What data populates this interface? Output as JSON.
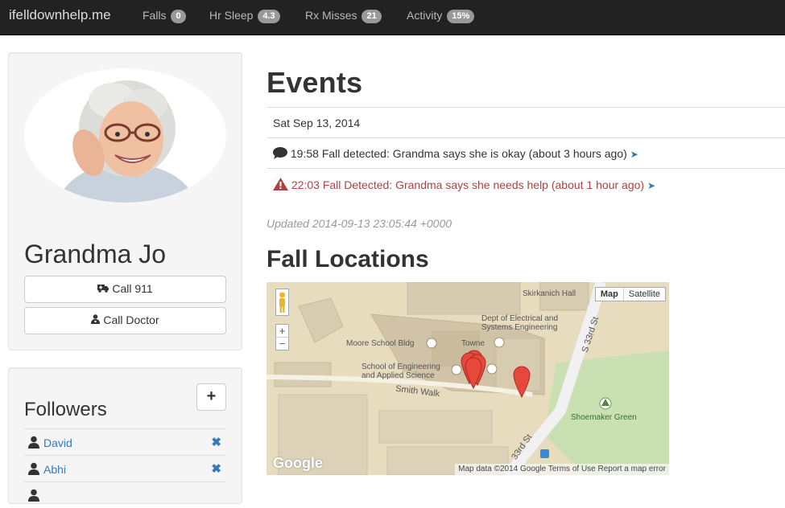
{
  "navbar": {
    "brand": "ifelldownhelp.me",
    "items": [
      {
        "label": "Falls",
        "badge": "0"
      },
      {
        "label": "Hr Sleep",
        "badge": "4.3"
      },
      {
        "label": "Rx Misses",
        "badge": "21"
      },
      {
        "label": "Activity",
        "badge": "15%"
      }
    ]
  },
  "profile": {
    "name": "Grandma Jo",
    "call_911": "Call 911",
    "call_doctor": "Call Doctor"
  },
  "followers": {
    "title": "Followers",
    "add_label": "+",
    "items": [
      {
        "name": "David"
      },
      {
        "name": "Abhi"
      }
    ]
  },
  "events": {
    "title": "Events",
    "date": "Sat Sep 13, 2014",
    "items": [
      {
        "text": "19:58 Fall detected: Grandma says she is okay (about 3 hours ago)",
        "type": "info",
        "icon": "comment-icon"
      },
      {
        "text": "22:03 Fall Detected: Grandma says she needs help (about 1 hour ago)",
        "type": "alert",
        "icon": "warning-icon"
      }
    ],
    "updated": "Updated 2014-09-13 23:05:44 +0000"
  },
  "fall_locations": {
    "title": "Fall Locations",
    "map": {
      "tab_map": "Map",
      "tab_satellite": "Satellite",
      "zoom_in": "+",
      "zoom_out": "−",
      "labels": {
        "skirkanich": "Skirkanich Hall",
        "dept": "Dept of Electrical and Systems Engineering",
        "moore": "Moore School Bldg",
        "towne": "Towne",
        "seas": "School of Engineering and Applied Science",
        "smith": "Smith Walk",
        "shoemaker": "Shoemaker Green",
        "s33": "S 33rd St",
        "s33b": "33rd St"
      },
      "logo": "Google",
      "footer": "Map data ©2014 Google    Terms of Use    Report a map error"
    }
  },
  "colors": {
    "navbar": "#222222",
    "link": "#337ab7",
    "alert": "#a94442",
    "marker": "#e8473b"
  }
}
